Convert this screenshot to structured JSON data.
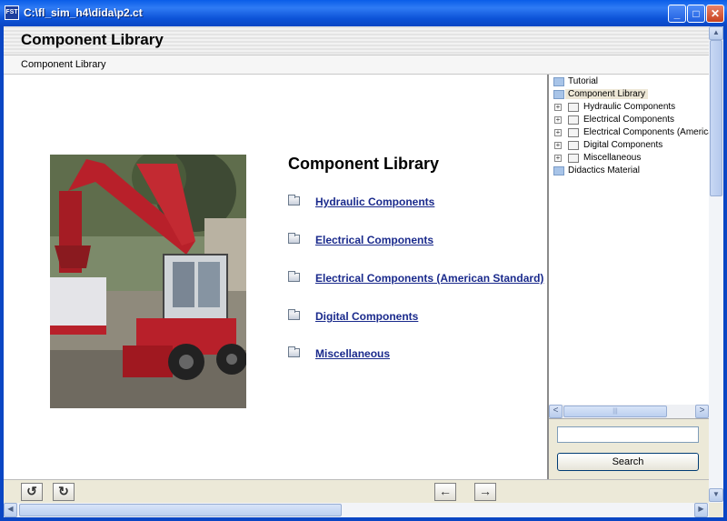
{
  "window": {
    "title": "C:\\fl_sim_h4\\dida\\p2.ct",
    "app_icon_text": "FST",
    "minimize_glyph": "_",
    "maximize_glyph": "□",
    "close_glyph": "✕"
  },
  "header": {
    "title": "Component Library"
  },
  "breadcrumb": {
    "text": "Component Library"
  },
  "content": {
    "title": "Component Library",
    "links": [
      {
        "label": "Hydraulic Components",
        "icon": "folder-icon"
      },
      {
        "label": "Electrical Components",
        "icon": "folder-icon"
      },
      {
        "label": "Electrical Components (American Standard)",
        "icon": "folder-icon"
      },
      {
        "label": "Digital Components",
        "icon": "folder-icon"
      },
      {
        "label": "Miscellaneous",
        "icon": "folder-icon"
      }
    ]
  },
  "tree": {
    "nodes": [
      {
        "label": "Tutorial",
        "level": 0,
        "expandable": false
      },
      {
        "label": "Component Library",
        "level": 0,
        "expandable": false,
        "selected": true
      },
      {
        "label": "Hydraulic Components",
        "level": 1,
        "expandable": true
      },
      {
        "label": "Electrical Components",
        "level": 1,
        "expandable": true
      },
      {
        "label": "Electrical Components (American",
        "level": 1,
        "expandable": true
      },
      {
        "label": "Digital Components",
        "level": 1,
        "expandable": true
      },
      {
        "label": "Miscellaneous",
        "level": 1,
        "expandable": true
      },
      {
        "label": "Didactics Material",
        "level": 0,
        "expandable": false
      }
    ],
    "scroll_left_glyph": "<",
    "scroll_right_glyph": ">",
    "thumb_grip": "|||"
  },
  "search": {
    "input_value": "",
    "button_label": "Search"
  },
  "navigation": {
    "reload_glyph": "↺",
    "refresh_glyph": "↻",
    "back_glyph": "←",
    "forward_glyph": "→"
  },
  "scrollbars": {
    "up_glyph": "▲",
    "down_glyph": "▼",
    "left_glyph": "◀",
    "right_glyph": "▶"
  },
  "colors": {
    "titlebar": "#0a5de8",
    "link": "#1a2a8c",
    "selection": "#ede7d6",
    "machine_red": "#b8202a"
  }
}
